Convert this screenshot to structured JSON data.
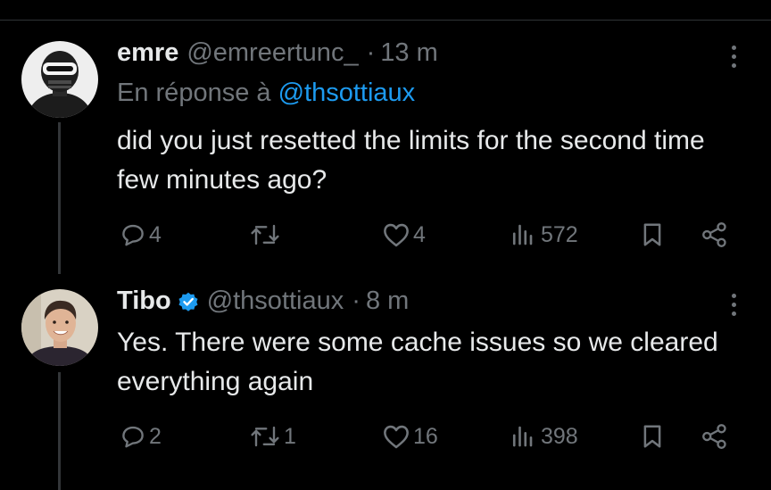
{
  "tweets": [
    {
      "name": "emre",
      "handle": "@emreertunc_",
      "separator": "·",
      "time": "13 m",
      "reply_prefix": "En réponse à ",
      "reply_mention": "@thsottiaux",
      "text": "did you just resetted the limits for the second time few minutes ago?",
      "verified": false,
      "counts": {
        "replies": "4",
        "reposts": "",
        "likes": "4",
        "views": "572"
      }
    },
    {
      "name": "Tibo",
      "handle": "@thsottiaux",
      "separator": "·",
      "time": "8 m",
      "text": "Yes. There were some cache issues so we cleared everything again",
      "verified": true,
      "counts": {
        "replies": "2",
        "reposts": "1",
        "likes": "16",
        "views": "398"
      }
    }
  ],
  "icons": [
    "reply-icon",
    "repost-icon",
    "like-icon",
    "views-icon",
    "bookmark-icon",
    "share-icon",
    "more-icon",
    "verified-badge-icon"
  ],
  "colors": {
    "background": "#000000",
    "text": "#e7e9ea",
    "muted": "#71767b",
    "link": "#1d9bf0",
    "verified": "#1d9bf0"
  }
}
